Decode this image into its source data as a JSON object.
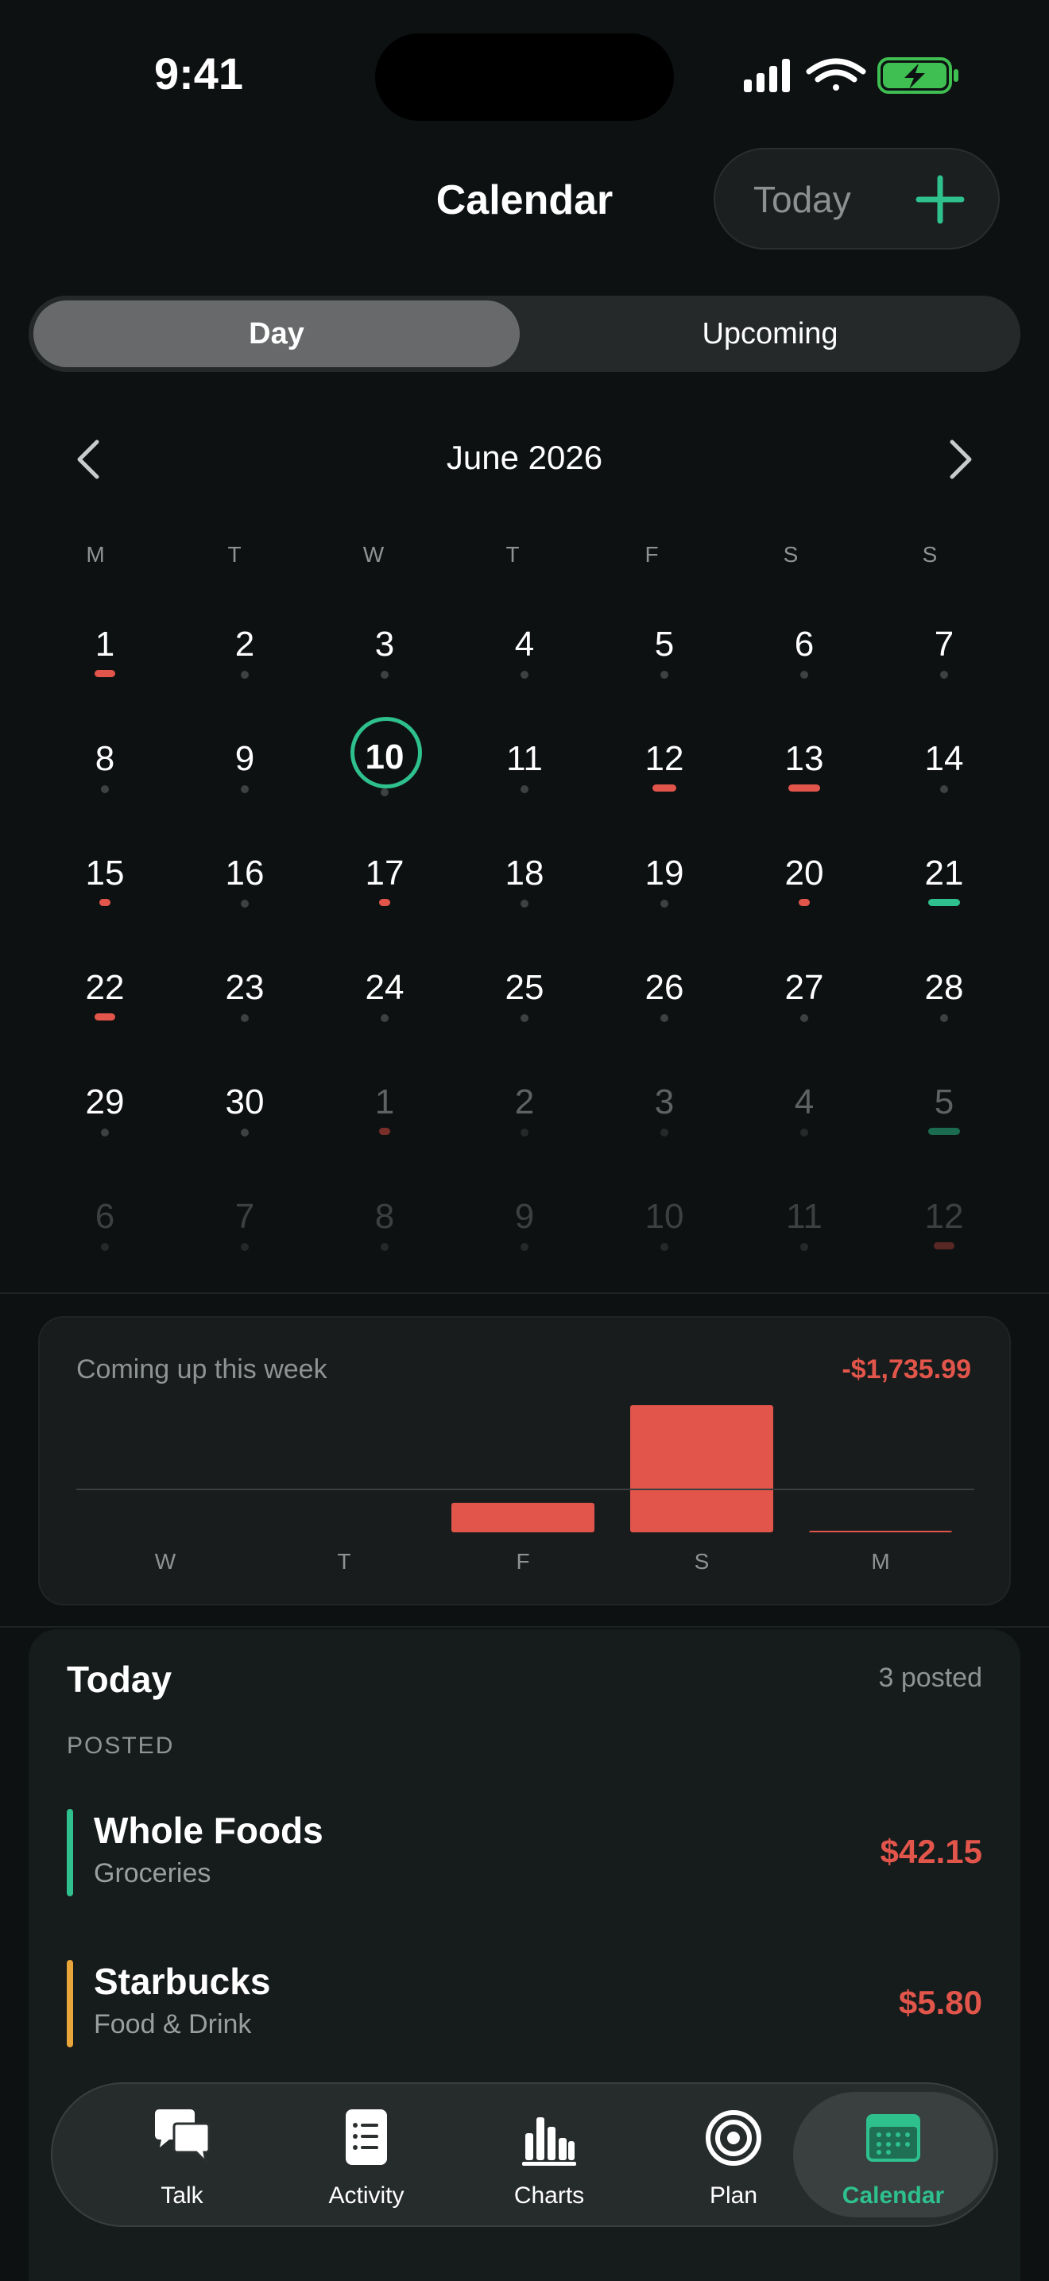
{
  "status": {
    "time": "9:41"
  },
  "header": {
    "title": "Calendar",
    "today_label": "Today"
  },
  "segments": {
    "day": "Day",
    "upcoming": "Upcoming"
  },
  "calendar": {
    "month_label": "June 2026",
    "weekdays": [
      "M",
      "T",
      "W",
      "T",
      "F",
      "S",
      "S"
    ],
    "selected_day": "10",
    "weeks": [
      [
        {
          "d": "1",
          "m": "red"
        },
        {
          "d": "2"
        },
        {
          "d": "3"
        },
        {
          "d": "4"
        },
        {
          "d": "5"
        },
        {
          "d": "6"
        },
        {
          "d": "7"
        }
      ],
      [
        {
          "d": "8"
        },
        {
          "d": "9"
        },
        {
          "d": "10",
          "sel": true
        },
        {
          "d": "11"
        },
        {
          "d": "12",
          "m": "red"
        },
        {
          "d": "13",
          "m": "red"
        },
        {
          "d": "14"
        }
      ],
      [
        {
          "d": "15",
          "m": "red"
        },
        {
          "d": "16"
        },
        {
          "d": "17",
          "m": "red"
        },
        {
          "d": "18"
        },
        {
          "d": "19"
        },
        {
          "d": "20",
          "m": "red"
        },
        {
          "d": "21",
          "m": "green"
        }
      ],
      [
        {
          "d": "22",
          "m": "red"
        },
        {
          "d": "23"
        },
        {
          "d": "24"
        },
        {
          "d": "25"
        },
        {
          "d": "26"
        },
        {
          "d": "27"
        },
        {
          "d": "28"
        }
      ],
      [
        {
          "d": "29"
        },
        {
          "d": "30"
        },
        {
          "d": "1",
          "o": "next",
          "m": "red"
        },
        {
          "d": "2",
          "o": "next"
        },
        {
          "d": "3",
          "o": "next"
        },
        {
          "d": "4",
          "o": "next"
        },
        {
          "d": "5",
          "o": "next",
          "m": "green"
        }
      ],
      [
        {
          "d": "6",
          "o": "next2"
        },
        {
          "d": "7",
          "o": "next2"
        },
        {
          "d": "8",
          "o": "next2"
        },
        {
          "d": "9",
          "o": "next2"
        },
        {
          "d": "10",
          "o": "next2"
        },
        {
          "d": "11",
          "o": "next2"
        },
        {
          "d": "12",
          "o": "next2",
          "m": "red"
        }
      ]
    ]
  },
  "week": {
    "title": "Coming up this week",
    "total": "-$1,735.99",
    "days": [
      "W",
      "T",
      "F",
      "S",
      "M"
    ],
    "amounts": [
      0,
      0,
      130,
      560,
      5
    ],
    "bar_color": "#e2554b"
  },
  "today": {
    "heading": "Today",
    "count": "3 posted",
    "posted_label": "POSTED",
    "transactions": [
      {
        "name": "Whole Foods",
        "category": "Groceries",
        "amount": "$42.15",
        "color": "#2ec08d"
      },
      {
        "name": "Starbucks",
        "category": "Food & Drink",
        "amount": "$5.80",
        "color": "#e8a53a"
      }
    ]
  },
  "tabs": [
    {
      "label": "Talk",
      "icon": "chat-bubbles-icon"
    },
    {
      "label": "Activity",
      "icon": "list-icon"
    },
    {
      "label": "Charts",
      "icon": "bar-chart-icon"
    },
    {
      "label": "Plan",
      "icon": "target-icon"
    },
    {
      "label": "Calendar",
      "icon": "calendar-icon",
      "active": true
    }
  ],
  "colors": {
    "accent": "#2ec08d",
    "expense": "#e2554b",
    "background": "#0e1112"
  }
}
